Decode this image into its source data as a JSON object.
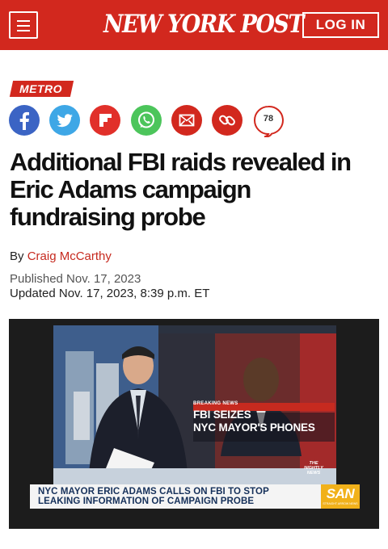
{
  "header": {
    "logo": "NEW YORK POST",
    "login_label": "LOG IN",
    "brand_color": "#d2281e"
  },
  "article": {
    "section": "METRO",
    "share_icons": [
      "facebook-icon",
      "twitter-icon",
      "flipboard-icon",
      "whatsapp-icon",
      "email-icon",
      "link-icon",
      "comments-icon"
    ],
    "comment_count": "78",
    "headline": "Additional FBI raids revealed in Eric Adams campaign fundraising probe",
    "byline_prefix": "By",
    "author": "Craig McCarthy",
    "published": "Published Nov. 17, 2023",
    "updated": "Updated Nov. 17, 2023, 8:39 p.m. ET"
  },
  "video": {
    "breaking_label": "BREAKING NEWS",
    "breaking_line1": "FBI SEIZES",
    "breaking_line2": "NYC MAYOR'S PHONES",
    "show_logo": "THE NIGHTLY NEWS",
    "lower_third_line1": "NYC MAYOR ERIC ADAMS CALLS ON FBI TO STOP",
    "lower_third_line2": "LEAKING INFORMATION OF CAMPAIGN PROBE",
    "network_logo": "SAN",
    "network_tagline": "STRAIGHT ARROW NEWS"
  }
}
